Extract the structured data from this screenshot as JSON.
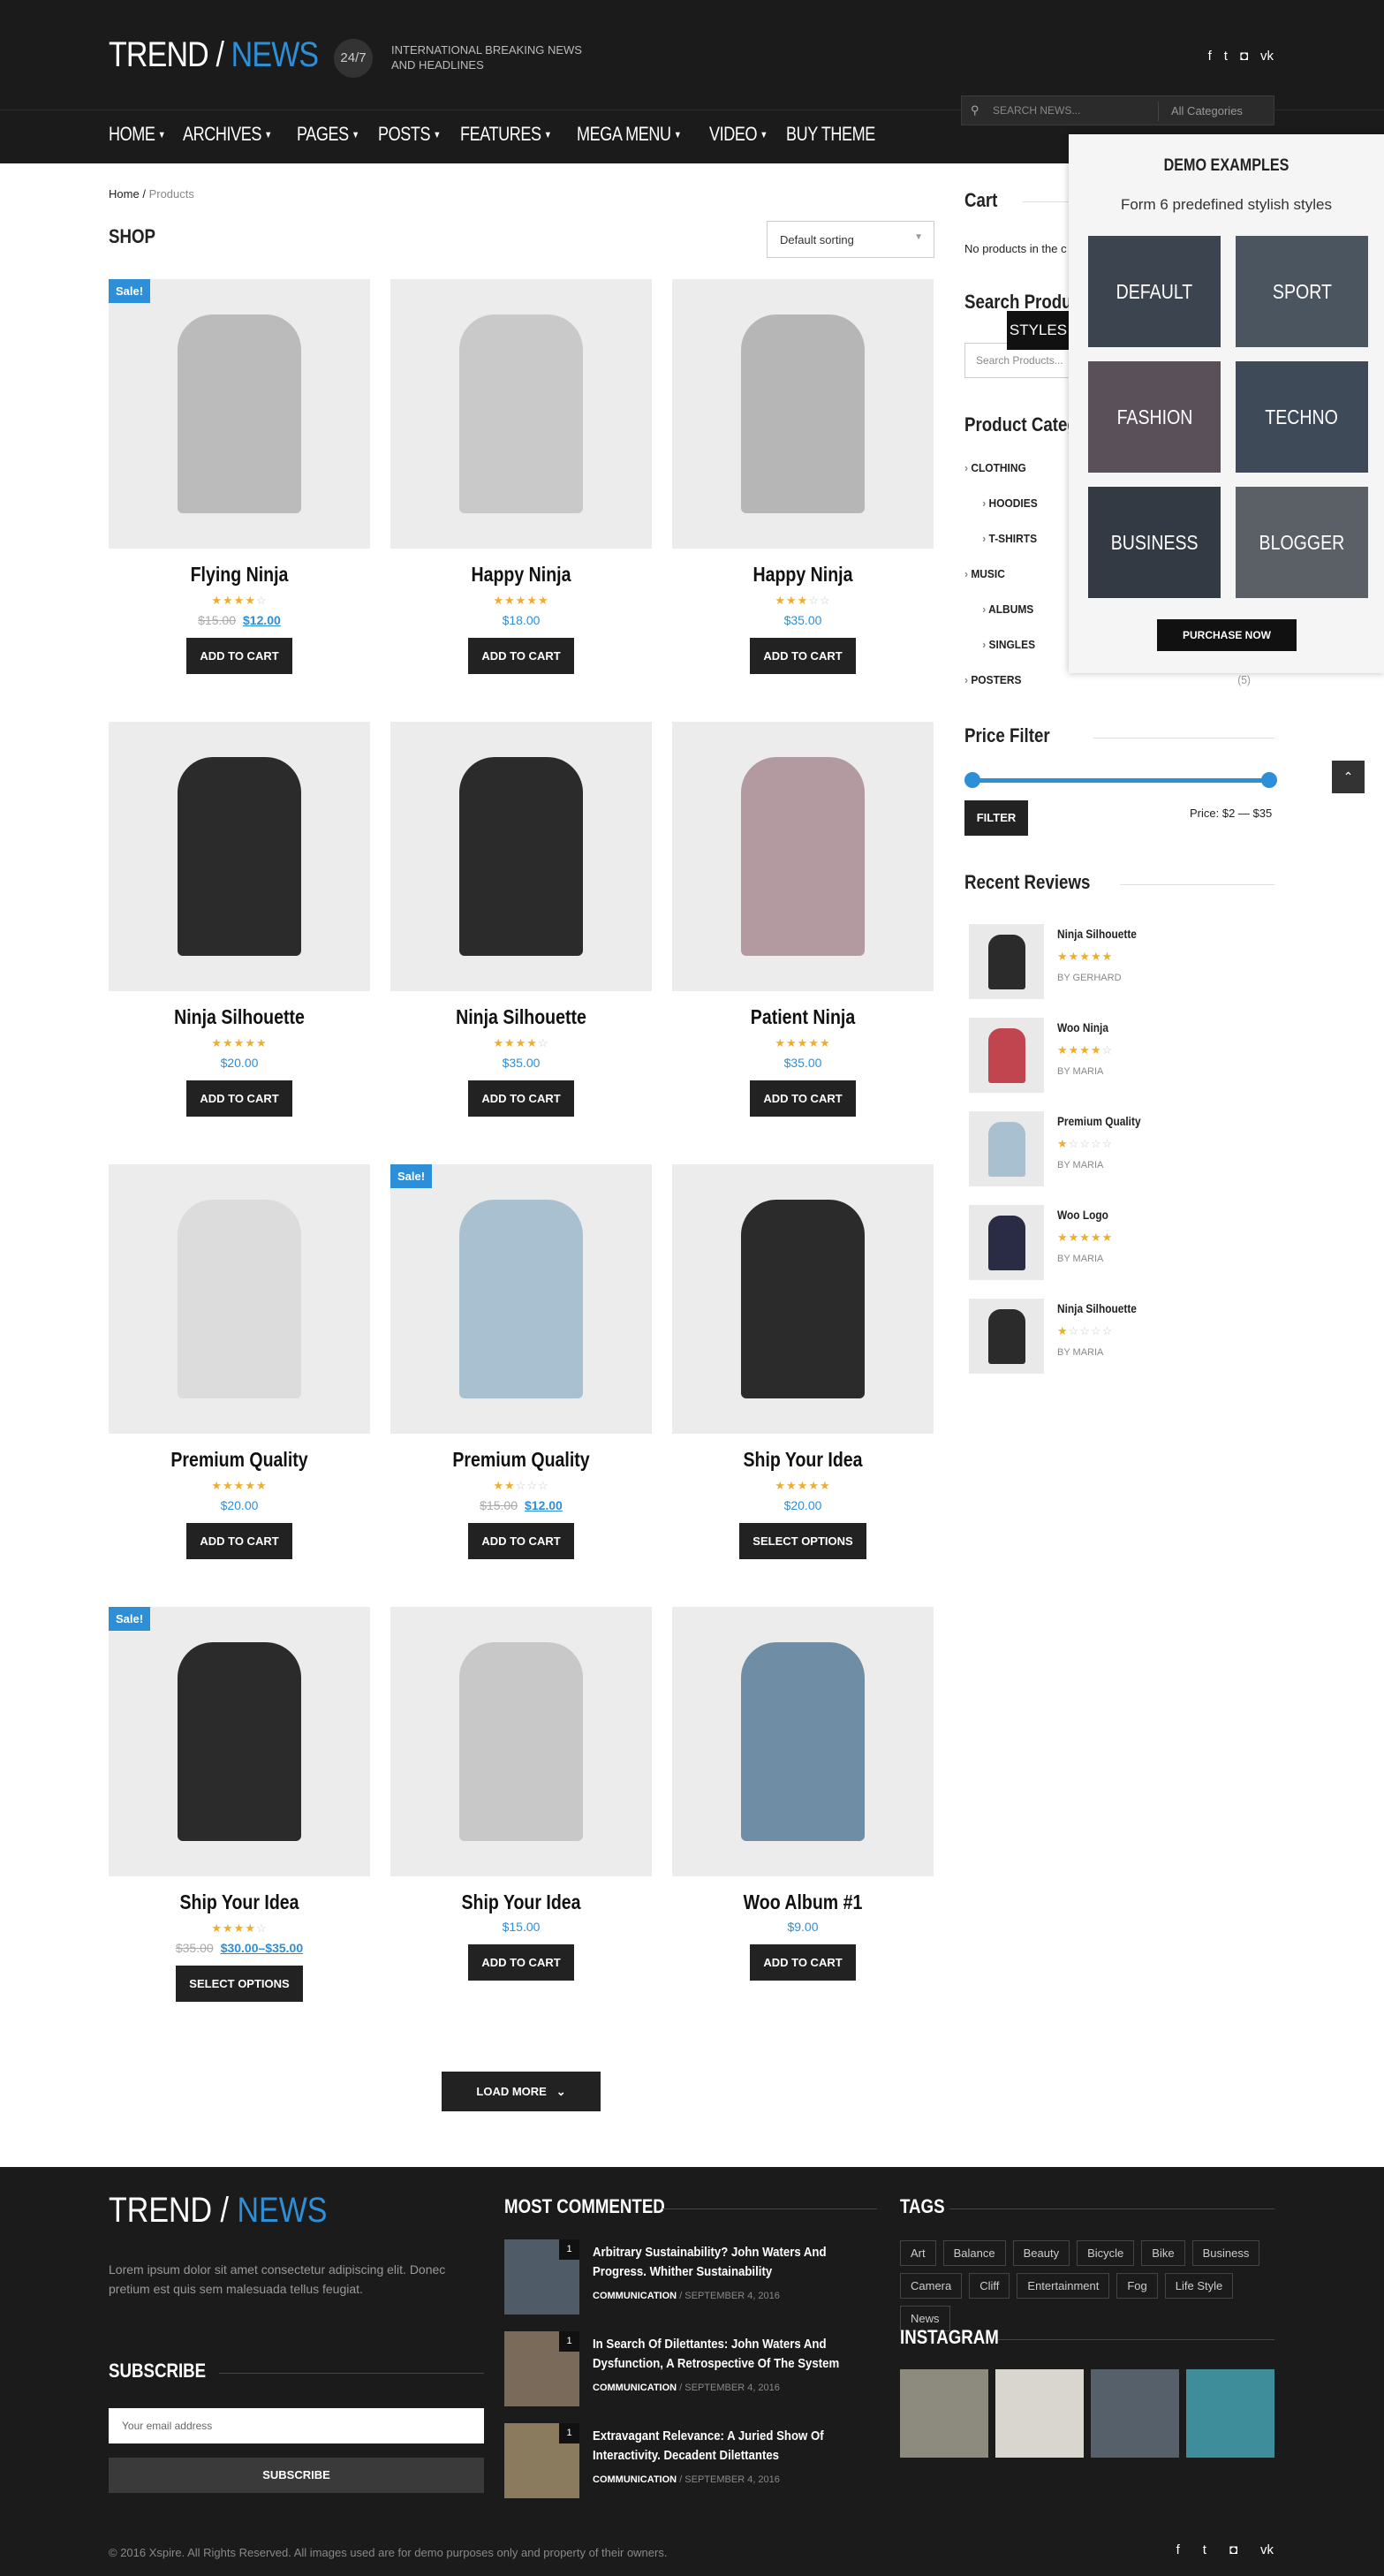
{
  "header": {
    "logo_a": "TREND / ",
    "logo_b": "NEWS",
    "badge": "24/7",
    "tagline": "INTERNATIONAL BREAKING NEWS AND HEADLINES",
    "social": [
      "f",
      "t",
      "ig",
      "vk"
    ],
    "search_placeholder": "SEARCH NEWS...",
    "search_category": "All Categories"
  },
  "nav": [
    {
      "label": "HOME",
      "caret": true
    },
    {
      "label": "ARCHIVES",
      "caret": true
    },
    {
      "label": "PAGES",
      "caret": true
    },
    {
      "label": "POSTS",
      "caret": true
    },
    {
      "label": "FEATURES",
      "caret": true
    },
    {
      "label": "MEGA MENU",
      "caret": true
    },
    {
      "label": "VIDEO",
      "caret": true
    },
    {
      "label": "BUY THEME",
      "caret": false
    }
  ],
  "breadcrumb": {
    "home": "Home",
    "sep": "/",
    "current": "Products"
  },
  "shop": {
    "title": "SHOP",
    "sort": "Default sorting",
    "load_more": "LOAD MORE"
  },
  "products": [
    {
      "name": "Flying Ninja",
      "rating": 4,
      "old": "$15.00",
      "price": "$12.00",
      "button": "ADD TO CART",
      "sale": true
    },
    {
      "name": "Happy Ninja",
      "rating": 5,
      "old": "",
      "price": "$18.00",
      "button": "ADD TO CART",
      "sale": false
    },
    {
      "name": "Happy Ninja",
      "rating": 3,
      "old": "",
      "price": "$35.00",
      "button": "ADD TO CART",
      "sale": false
    },
    {
      "name": "Ninja Silhouette",
      "rating": 5,
      "old": "",
      "price": "$20.00",
      "button": "ADD TO CART",
      "sale": false
    },
    {
      "name": "Ninja Silhouette",
      "rating": 4,
      "old": "",
      "price": "$35.00",
      "button": "ADD TO CART",
      "sale": false
    },
    {
      "name": "Patient Ninja",
      "rating": 5,
      "old": "",
      "price": "$35.00",
      "button": "ADD TO CART",
      "sale": false
    },
    {
      "name": "Premium Quality",
      "rating": 4.5,
      "old": "",
      "price": "$20.00",
      "button": "ADD TO CART",
      "sale": false
    },
    {
      "name": "Premium Quality",
      "rating": 2,
      "old": "$15.00",
      "price": "$12.00",
      "button": "ADD TO CART",
      "sale": true
    },
    {
      "name": "Ship Your Idea",
      "rating": 4.5,
      "old": "",
      "price": "$20.00",
      "button": "SELECT OPTIONS",
      "sale": false
    },
    {
      "name": "Ship Your Idea",
      "rating": 4,
      "old": "$35.00",
      "price": "$30.00–$35.00",
      "button": "SELECT OPTIONS",
      "sale": true
    },
    {
      "name": "Ship Your Idea",
      "rating": 0,
      "old": "",
      "price": "$15.00",
      "button": "ADD TO CART",
      "sale": false
    },
    {
      "name": "Woo Album #1",
      "rating": 0,
      "old": "",
      "price": "$9.00",
      "button": "ADD TO CART",
      "sale": false
    }
  ],
  "sale_label": "Sale!",
  "sidebar": {
    "cart_title": "Cart",
    "cart_empty": "No products in the c",
    "search_title": "Search Produc",
    "search_placeholder": "Search Products...",
    "cat_title": "Product Categ",
    "categories": [
      {
        "label": "CLOTHING",
        "count": "",
        "indent": 0
      },
      {
        "label": "HOODIES",
        "count": "",
        "indent": 1
      },
      {
        "label": "T-SHIRTS",
        "count": "",
        "indent": 1
      },
      {
        "label": "MUSIC",
        "count": "",
        "indent": 0
      },
      {
        "label": "ALBUMS",
        "count": "",
        "indent": 1
      },
      {
        "label": "SINGLES",
        "count": "",
        "indent": 1
      },
      {
        "label": "POSTERS",
        "count": "(5)",
        "indent": 0
      }
    ],
    "price_title": "Price Filter",
    "filter_btn": "FILTER",
    "price_range": "Price: $2 — $35",
    "price_min_frac": 0.0,
    "price_max_frac": 1.0,
    "reviews_title": "Recent Reviews",
    "reviews": [
      {
        "name": "Ninja Silhouette",
        "rating": 5,
        "by": "BY GERHARD"
      },
      {
        "name": "Woo Ninja",
        "rating": 4,
        "by": "BY MARIA"
      },
      {
        "name": "Premium Quality",
        "rating": 1,
        "by": "BY MARIA"
      },
      {
        "name": "Woo Logo",
        "rating": 5,
        "by": "BY MARIA"
      },
      {
        "name": "Ninja Silhouette",
        "rating": 1,
        "by": "BY MARIA"
      }
    ]
  },
  "demo": {
    "title": "DEMO EXAMPLES",
    "subtitle": "Form 6 predefined stylish styles",
    "tiles": [
      "DEFAULT",
      "SPORT",
      "FASHION",
      "TECHNO",
      "BUSINESS",
      "BLOGGER"
    ],
    "purchase": "PURCHASE NOW",
    "styles_tab": "STYLES"
  },
  "footer": {
    "desc": "Lorem ipsum dolor sit amet consectetur adipiscing elit. Donec pretium est quis sem malesuada tellus feugiat.",
    "subscribe_title": "SUBSCRIBE",
    "email_placeholder": "Your email address",
    "subscribe_btn": "SUBSCRIBE",
    "most_commented_title": "MOST COMMENTED",
    "most_commented": [
      {
        "title": "Arbitrary Sustainability? John Waters And Progress. Whither Sustainability",
        "cat": "COMMUNICATION",
        "date": "SEPTEMBER 4, 2016",
        "count": "1"
      },
      {
        "title": "In Search Of Dilettantes: John Waters And Dysfunction, A Retrospective Of The System",
        "cat": "COMMUNICATION",
        "date": "SEPTEMBER 4, 2016",
        "count": "1"
      },
      {
        "title": "Extravagant Relevance: A Juried Show Of Interactivity. Decadent Dilettantes",
        "cat": "COMMUNICATION",
        "date": "SEPTEMBER 4, 2016",
        "count": "1"
      }
    ],
    "tags_title": "TAGS",
    "tags": [
      "Art",
      "Balance",
      "Beauty",
      "Bicycle",
      "Bike",
      "Business",
      "Camera",
      "Cliff",
      "Entertainment",
      "Fog",
      "Life Style",
      "News"
    ],
    "instagram_title": "INSTAGRAM",
    "copyright": "© 2016 Xspire. All Rights Reserved. All images used are for demo purposes only and property of their owners.",
    "social": [
      "f",
      "t",
      "ig",
      "vk"
    ]
  }
}
